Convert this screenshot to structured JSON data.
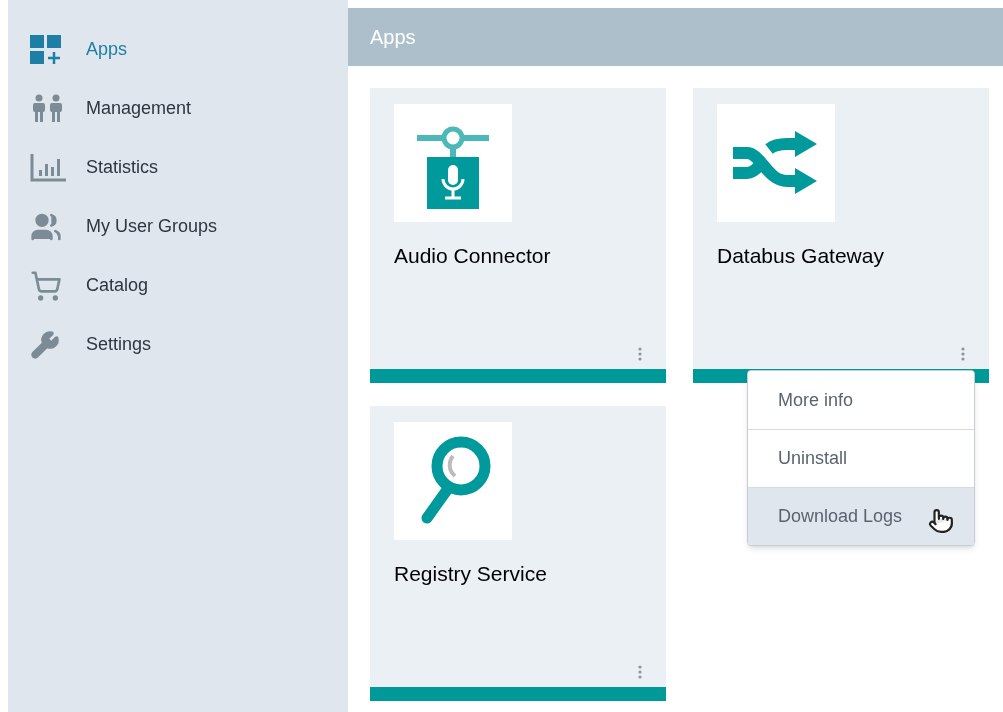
{
  "sidebar": {
    "items": [
      {
        "label": "Apps",
        "kind": "apps",
        "selected": true
      },
      {
        "label": "Management",
        "kind": "people",
        "selected": false
      },
      {
        "label": "Statistics",
        "kind": "stats",
        "selected": false
      },
      {
        "label": "My User Groups",
        "kind": "groups",
        "selected": false
      },
      {
        "label": "Catalog",
        "kind": "cart",
        "selected": false
      },
      {
        "label": "Settings",
        "kind": "wrench",
        "selected": false
      }
    ]
  },
  "header": {
    "title": "Apps"
  },
  "apps": [
    {
      "name": "Audio Connector",
      "kind": "microphone",
      "menu_open": false
    },
    {
      "name": "Databus Gateway",
      "kind": "shuffle",
      "menu_open": true
    },
    {
      "name": "Registry Service",
      "kind": "magnifier",
      "menu_open": false
    }
  ],
  "context_menu": {
    "items": [
      {
        "label": "More info",
        "selected": false
      },
      {
        "label": "Uninstall",
        "selected": false
      },
      {
        "label": "Download Logs",
        "selected": true
      }
    ]
  }
}
